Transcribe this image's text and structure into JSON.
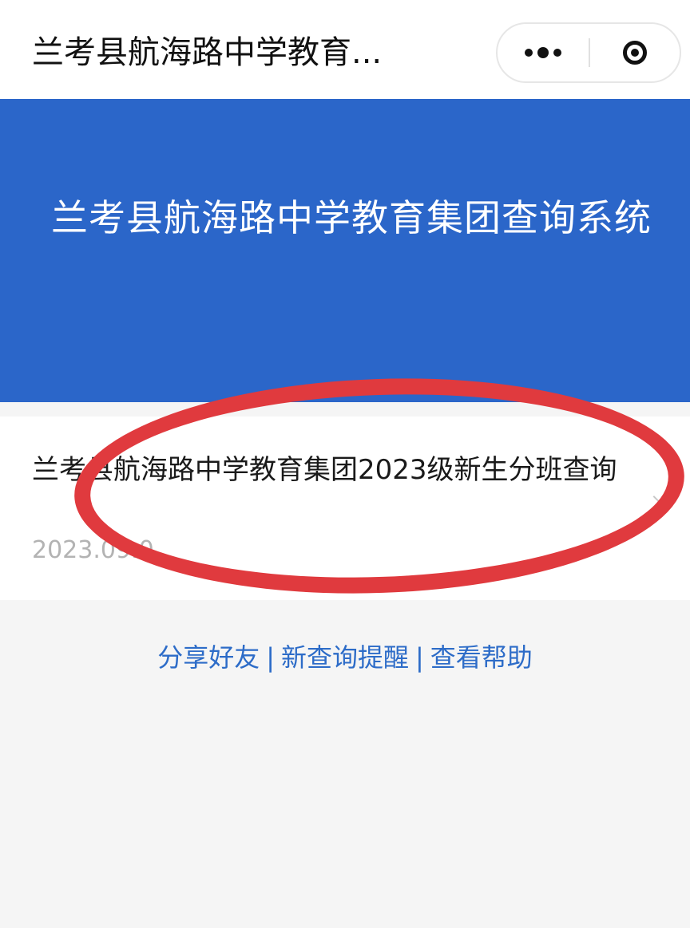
{
  "nav": {
    "title": "兰考县航海路中学教育...",
    "more_icon": "more-dots-icon",
    "close_icon": "target-circle-icon"
  },
  "banner": {
    "title": "兰考县航海路中学教育集团查询系统",
    "background": "#2b66c9"
  },
  "result": {
    "title": "兰考县航海路中学教育集团2023级新生分班查询",
    "date": "2023.09.0"
  },
  "footer": {
    "links": [
      "分享好友",
      "新查询提醒",
      "查看帮助"
    ],
    "separator": "|",
    "color": "#2d6cc8"
  },
  "annotation": {
    "color": "#e03a3e"
  }
}
